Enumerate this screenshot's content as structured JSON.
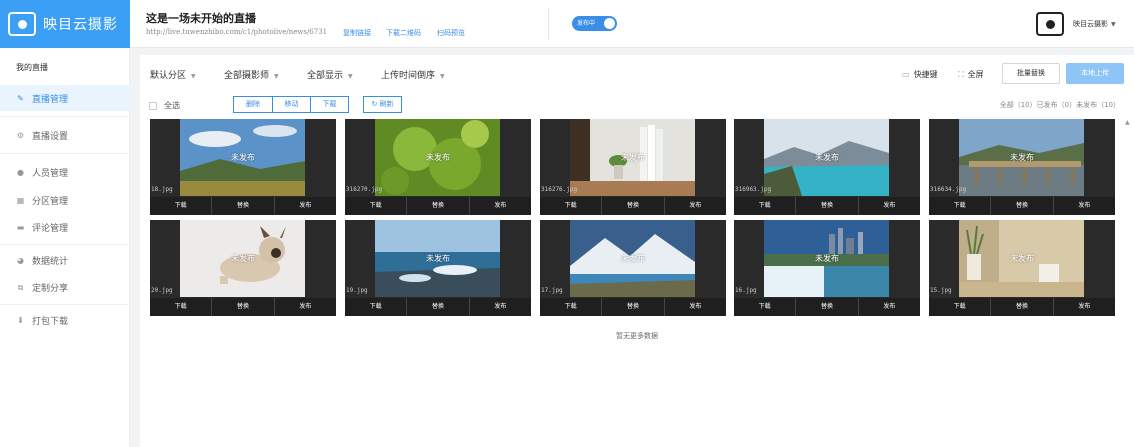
{
  "brand": {
    "logo_text": "映目云摄影"
  },
  "header": {
    "title": "这是一场未开始的直播",
    "url": "http://live.tuwenzhibo.com/c1/photolive/news/6731",
    "links": [
      "复制链接",
      "下载二维码",
      "扫码预览"
    ],
    "publish_toggle": "发布中",
    "user_name": "映目云摄影"
  },
  "sidebar": {
    "section_title": "我的直播",
    "items": [
      {
        "label": "直播管理",
        "icon": "edit-icon",
        "active": true
      },
      {
        "label": "直播设置",
        "icon": "gear-icon"
      },
      {
        "label": "人员管理",
        "icon": "person-icon"
      },
      {
        "label": "分区管理",
        "icon": "grid-icon"
      },
      {
        "label": "评论管理",
        "icon": "comment-icon"
      },
      {
        "label": "数据统计",
        "icon": "pie-chart-icon"
      },
      {
        "label": "定制分享",
        "icon": "share-icon"
      },
      {
        "label": "打包下载",
        "icon": "download-icon"
      }
    ]
  },
  "toolbar": {
    "filters": [
      "默认分区",
      "全部摄影师",
      "全部显示",
      "上传时间倒序"
    ],
    "shortcut": "快捷键",
    "fullscreen": "全屏",
    "batch_replace": "批量替换",
    "local_upload": "本地上传"
  },
  "actions": {
    "select_all": "全选",
    "buttons": [
      "删除",
      "移动",
      "下载"
    ],
    "refresh": "刷新",
    "counts": "全部（10）已发布（0）未发布（10）"
  },
  "photos": [
    {
      "file": "18.jpg",
      "scene": "sky-field"
    },
    {
      "file": "316270.jpg",
      "scene": "leaves"
    },
    {
      "file": "316276.jpg",
      "scene": "books"
    },
    {
      "file": "316963.jpg",
      "scene": "lake-mountain"
    },
    {
      "file": "316634.jpg",
      "scene": "bridge"
    },
    {
      "file": "20.jpg",
      "scene": "dog"
    },
    {
      "file": "19.jpg",
      "scene": "sea-rocks"
    },
    {
      "file": "17.jpg",
      "scene": "mountain-lake"
    },
    {
      "file": "16.jpg",
      "scene": "waterfall-city"
    },
    {
      "file": "15.jpg",
      "scene": "cup-plant"
    }
  ],
  "card_labels": {
    "status": "未发布",
    "download": "下载",
    "replace": "替换",
    "publish": "发布"
  },
  "footer_text": "暂无更多数据",
  "colors": {
    "primary": "#3a8ee6",
    "logo_bg": "#3a9ff5",
    "upload_btn": "#8ec5f7"
  }
}
